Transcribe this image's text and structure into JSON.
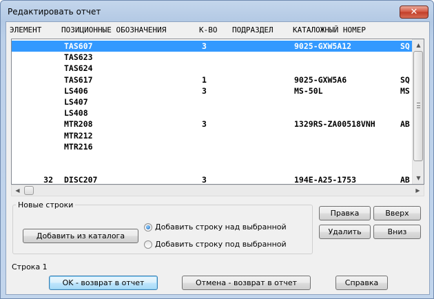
{
  "window": {
    "title": "Редактировать отчет",
    "close_glyph": "✕"
  },
  "columns": [
    "ЭЛЕМЕНТ",
    "ПОЗИЦИОННЫЕ ОБОЗНАЧЕНИЯ",
    "К-ВО",
    "ПОДРАЗДЕЛ",
    "КАТАЛОЖНЫЙ НОМЕР"
  ],
  "rows": [
    {
      "el": "",
      "pos": "TAS607",
      "qty": "3",
      "cat": "9025-GXW5A12",
      "desc": "SQ",
      "selected": true
    },
    {
      "el": "",
      "pos": "TAS623",
      "qty": "",
      "cat": "",
      "desc": ""
    },
    {
      "el": "",
      "pos": "TAS624",
      "qty": "",
      "cat": "",
      "desc": ""
    },
    {
      "el": "",
      "pos": "TAS617",
      "qty": "1",
      "cat": "9025-GXW5A6",
      "desc": "SQ"
    },
    {
      "el": "",
      "pos": "LS406",
      "qty": "3",
      "cat": "MS-50L",
      "desc": "MS"
    },
    {
      "el": "",
      "pos": "LS407",
      "qty": "",
      "cat": "",
      "desc": ""
    },
    {
      "el": "",
      "pos": "LS408",
      "qty": "",
      "cat": "",
      "desc": ""
    },
    {
      "el": "",
      "pos": "MTR208",
      "qty": "3",
      "cat": "1329RS-ZA00518VNH",
      "desc": "AB"
    },
    {
      "el": "",
      "pos": "MTR212",
      "qty": "",
      "cat": "",
      "desc": ""
    },
    {
      "el": "",
      "pos": "MTR216",
      "qty": "",
      "cat": "",
      "desc": ""
    },
    {
      "el": "",
      "pos": "",
      "qty": "",
      "cat": "",
      "desc": ""
    },
    {
      "el": "",
      "pos": "",
      "qty": "",
      "cat": "",
      "desc": ""
    },
    {
      "el": "32",
      "pos": "DISC207",
      "qty": "3",
      "cat": "194E-A25-1753",
      "desc": "AB"
    }
  ],
  "group": {
    "legend": "Новые строки",
    "add_from_catalog": "Добавить из каталога",
    "radio_above": "Добавить строку над выбранной",
    "radio_below": "Добавить строку под выбранной",
    "selected": "above"
  },
  "buttons": {
    "edit": "Правка",
    "up": "Вверх",
    "delete": "Удалить",
    "down": "Вниз",
    "ok": "OK - возврат в отчет",
    "cancel": "Отмена - возврат в отчет",
    "help": "Справка"
  },
  "status": "Строка 1"
}
